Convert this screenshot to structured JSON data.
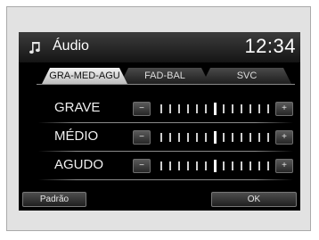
{
  "header": {
    "app_icon": "music-note-icon",
    "title": "Áudio",
    "clock": "12:34"
  },
  "tabs": [
    {
      "label": "GRA-MED-AGU",
      "active": true
    },
    {
      "label": "FAD-BAL",
      "active": false
    },
    {
      "label": "SVC",
      "active": false
    }
  ],
  "settings": [
    {
      "label": "GRAVE",
      "minus_label": "−",
      "plus_label": "+",
      "value": 0,
      "min": -6,
      "max": 6
    },
    {
      "label": "MÉDIO",
      "minus_label": "−",
      "plus_label": "+",
      "value": 0,
      "min": -6,
      "max": 6
    },
    {
      "label": "AGUDO",
      "minus_label": "−",
      "plus_label": "+",
      "value": 0,
      "min": -6,
      "max": 6
    }
  ],
  "footer": {
    "default_label": "Padrão",
    "ok_label": "OK"
  },
  "colors": {
    "screen_background": "#000000",
    "text": "#ffffff",
    "active_tab": "#e6e6e6",
    "frame_background": "#e2e2e2"
  }
}
